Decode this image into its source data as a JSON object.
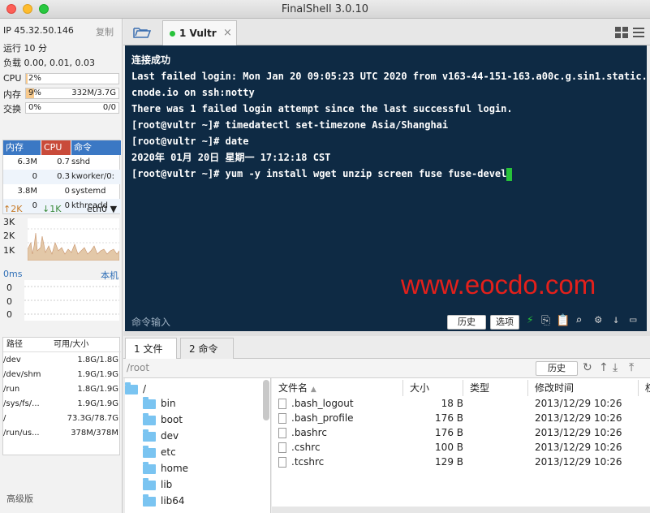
{
  "window": {
    "title": "FinalShell 3.0.10"
  },
  "sidebar": {
    "ip": "IP 45.32.50.146",
    "copy_label": "复制",
    "uptime": "运行 10 分",
    "load": "负载 0.00, 0.01, 0.03",
    "cpu": {
      "label": "CPU",
      "value": "2%",
      "percent": 2
    },
    "mem": {
      "label": "内存",
      "percent_text": "9%",
      "detail": "332M/3.7G",
      "percent": 9
    },
    "swap": {
      "label": "交换",
      "percent_text": "0%",
      "detail": "0/0",
      "percent": 0
    },
    "process_headers": [
      "内存",
      "CPU",
      "命令"
    ],
    "processes": [
      {
        "mem": "6.3M",
        "cpu": "0.7",
        "cmd": "sshd"
      },
      {
        "mem": "0",
        "cpu": "0.3",
        "cmd": "kworker/0:"
      },
      {
        "mem": "3.8M",
        "cpu": "0",
        "cmd": "systemd"
      },
      {
        "mem": "0",
        "cpu": "0",
        "cmd": "kthreadd"
      }
    ],
    "net": {
      "up": "2K",
      "down": "1K",
      "iface": "eth0",
      "ticks": [
        "3K",
        "2K",
        "1K"
      ]
    },
    "latency": {
      "value": "0ms",
      "host": "本机",
      "ticks": [
        "0",
        "0",
        "0"
      ]
    },
    "disk_headers": [
      "路径",
      "可用/大小"
    ],
    "disks": [
      {
        "path": "/dev",
        "size": "1.8G/1.8G"
      },
      {
        "path": "/dev/shm",
        "size": "1.9G/1.9G"
      },
      {
        "path": "/run",
        "size": "1.8G/1.9G"
      },
      {
        "path": "/sys/fs/...",
        "size": "1.9G/1.9G"
      },
      {
        "path": "/",
        "size": "73.3G/78.7G"
      },
      {
        "path": "/run/us...",
        "size": "378M/378M"
      }
    ],
    "edition": "高级版"
  },
  "tabs": [
    {
      "label": "1 Vultr",
      "active": true
    }
  ],
  "terminal": {
    "lines": [
      "连接成功",
      "Last failed login: Mon Jan 20 09:05:23 UTC 2020 from v163-44-151-163.a00c.g.sin1.static.",
      "cnode.io on ssh:notty",
      "There was 1 failed login attempt since the last successful login.",
      "[root@vultr ~]# timedatectl set-timezone Asia/Shanghai",
      "[root@vultr ~]# date",
      "2020年 01月 20日 星期一 17:12:18 CST",
      "[root@vultr ~]# yum -y install wget unzip screen fuse fuse-devel"
    ],
    "watermark": "www.eocdo.com",
    "input_label": "命令输入",
    "history_btn": "历史",
    "options_btn": "选项"
  },
  "bottom_tabs": [
    {
      "label": "1 文件"
    },
    {
      "label": "2 命令"
    }
  ],
  "path": {
    "value": "/root",
    "history_btn": "历史"
  },
  "tree": {
    "root": "/",
    "items": [
      "bin",
      "boot",
      "dev",
      "etc",
      "home",
      "lib",
      "lib64"
    ]
  },
  "files": {
    "headers": [
      "文件名",
      "大小",
      "类型",
      "修改时间",
      "权"
    ],
    "rows": [
      {
        "name": ".bash_logout",
        "size": "18 B",
        "type": "",
        "mtime": "2013/12/29 10:26"
      },
      {
        "name": ".bash_profile",
        "size": "176 B",
        "type": "",
        "mtime": "2013/12/29 10:26"
      },
      {
        "name": ".bashrc",
        "size": "176 B",
        "type": "",
        "mtime": "2013/12/29 10:26"
      },
      {
        "name": ".cshrc",
        "size": "100 B",
        "type": "",
        "mtime": "2013/12/29 10:26"
      },
      {
        "name": ".tcshrc",
        "size": "129 B",
        "type": "",
        "mtime": "2013/12/29 10:26"
      }
    ]
  },
  "colors": {
    "accent": "#2f6fb7",
    "watermark": "#e3201b",
    "terminal_bg": "#0e2a44",
    "green": "#27c23a"
  }
}
